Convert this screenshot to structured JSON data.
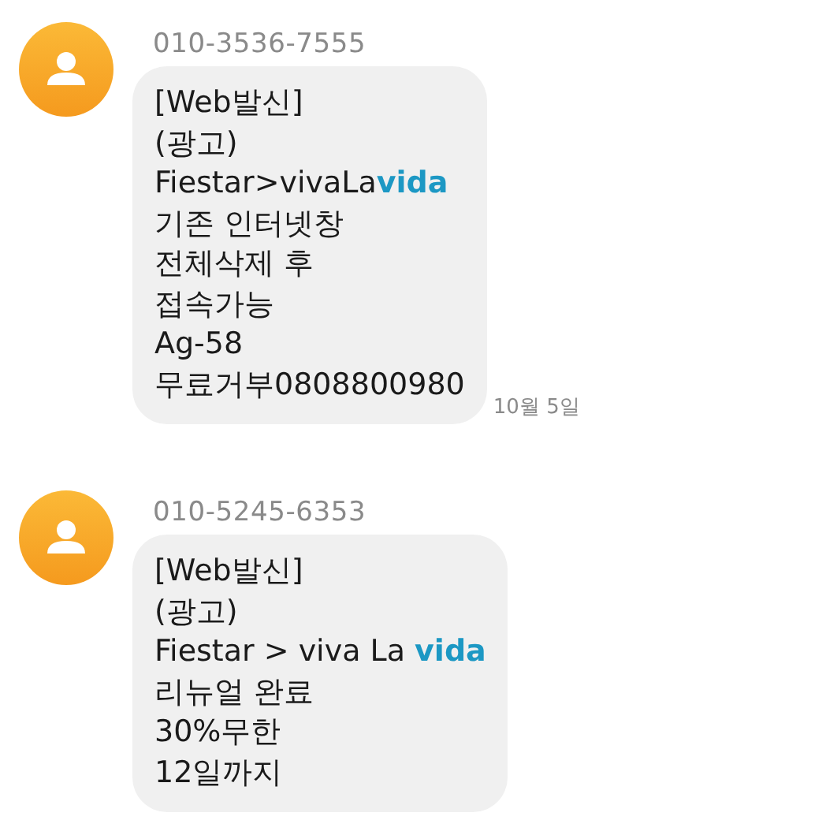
{
  "messages": [
    {
      "sender": "010-3536-7555",
      "lines": [
        {
          "text": "[Web발신]"
        },
        {
          "text": "(광고)"
        },
        {
          "text": "Fiestar>vivaLa",
          "link": "vida"
        },
        {
          "text": "기존 인터넷창"
        },
        {
          "text": "전체삭제 후"
        },
        {
          "text": "접속가능"
        },
        {
          "text": "Ag-58"
        },
        {
          "text": "무료거부0808800980"
        }
      ],
      "time": "10월 5일"
    },
    {
      "sender": "010-5245-6353",
      "lines": [
        {
          "text": "[Web발신]"
        },
        {
          "text": "(광고)"
        },
        {
          "text": "Fiestar > viva La ",
          "link": "vida"
        },
        {
          "text": "리뉴얼 완료"
        },
        {
          "text": "30%무한"
        },
        {
          "text": "12일까지"
        }
      ]
    }
  ]
}
